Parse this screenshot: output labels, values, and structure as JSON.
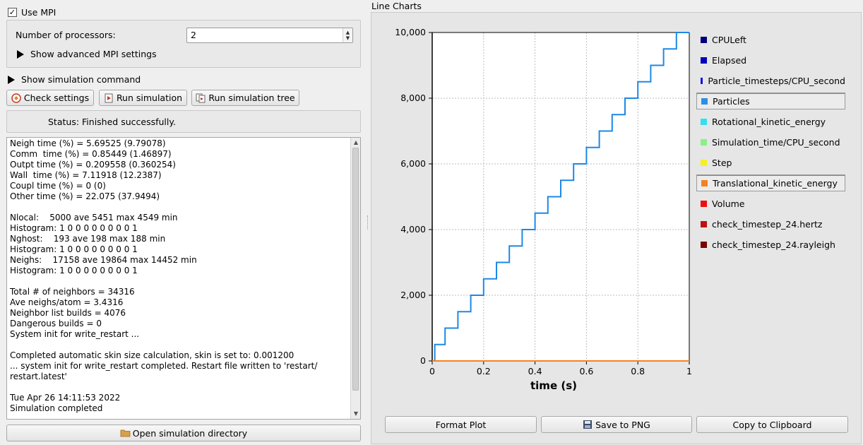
{
  "mpi": {
    "use_mpi_label": "Use MPI",
    "use_mpi_checked": true,
    "processors_label": "Number of processors:",
    "processors_value": "2",
    "advanced_label": "Show advanced MPI settings"
  },
  "simulation_command_label": "Show simulation command",
  "toolbar": {
    "check_settings": "Check settings",
    "run_simulation": "Run simulation",
    "run_simulation_tree": "Run simulation tree"
  },
  "status_text": "Status: Finished successfully.",
  "log_lines": [
    "Neigh time (%) = 5.69525 (9.79078)",
    "Comm  time (%) = 0.85449 (1.46897)",
    "Outpt time (%) = 0.209558 (0.360254)",
    "Wall  time (%) = 7.11918 (12.2387)",
    "Coupl time (%) = 0 (0)",
    "Other time (%) = 22.075 (37.9494)",
    "",
    "Nlocal:    5000 ave 5451 max 4549 min",
    "Histogram: 1 0 0 0 0 0 0 0 0 1",
    "Nghost:    193 ave 198 max 188 min",
    "Histogram: 1 0 0 0 0 0 0 0 0 1",
    "Neighs:    17158 ave 19864 max 14452 min",
    "Histogram: 1 0 0 0 0 0 0 0 0 1",
    "",
    "Total # of neighbors = 34316",
    "Ave neighs/atom = 3.4316",
    "Neighbor list builds = 4076",
    "Dangerous builds = 0",
    "System init for write_restart ...",
    "",
    "Completed automatic skin size calculation, skin is set to: 0.001200",
    "... system init for write_restart completed. Restart file written to 'restart/",
    "restart.latest'",
    "",
    "Tue Apr 26 14:11:53 2022",
    "Simulation completed"
  ],
  "open_dir_label": "Open simulation directory",
  "chart_panel_title": "Line Charts",
  "chart_data": {
    "type": "line",
    "xlabel": "time (s)",
    "ylabel": "",
    "xlim": [
      0,
      1
    ],
    "ylim": [
      0,
      10000
    ],
    "x_ticks": [
      "0",
      "0.2",
      "0.4",
      "0.6",
      "0.8",
      "1"
    ],
    "y_ticks": [
      "0",
      "2,000",
      "4,000",
      "6,000",
      "8,000",
      "10,000"
    ],
    "x_tick_values": [
      0,
      0.2,
      0.4,
      0.6,
      0.8,
      1
    ],
    "y_tick_values": [
      0,
      2000,
      4000,
      6000,
      8000,
      10000
    ],
    "grid": true,
    "series": [
      {
        "name": "Particles",
        "color": "#1e88e5",
        "step": true,
        "x": [
          0,
          0.01,
          0.05,
          0.1,
          0.15,
          0.2,
          0.25,
          0.3,
          0.35,
          0.4,
          0.45,
          0.5,
          0.55,
          0.6,
          0.65,
          0.7,
          0.75,
          0.8,
          0.85,
          0.9,
          0.95,
          1.0
        ],
        "y": [
          0,
          500,
          1000,
          1500,
          2000,
          2500,
          3000,
          3500,
          4000,
          4500,
          5000,
          5500,
          6000,
          6500,
          7000,
          7500,
          8000,
          8500,
          9000,
          9500,
          10000,
          10000
        ]
      },
      {
        "name": "Translational_kinetic_energy",
        "color": "#f5821f",
        "step": false,
        "x": [
          0,
          1
        ],
        "y": [
          0,
          0
        ]
      }
    ]
  },
  "legend": [
    {
      "label": "CPULeft",
      "color": "#00007a",
      "selected": false
    },
    {
      "label": "Elapsed",
      "color": "#0000b8",
      "selected": false
    },
    {
      "label": "Particle_timesteps/CPU_second",
      "color": "#1010e8",
      "selected": false
    },
    {
      "label": "Particles",
      "color": "#2d8fe3",
      "selected": true
    },
    {
      "label": "Rotational_kinetic_energy",
      "color": "#33e0f0",
      "selected": false
    },
    {
      "label": "Simulation_time/CPU_second",
      "color": "#88f288",
      "selected": false
    },
    {
      "label": "Step",
      "color": "#f5f020",
      "selected": false
    },
    {
      "label": "Translational_kinetic_energy",
      "color": "#f5821f",
      "selected": true
    },
    {
      "label": "Volume",
      "color": "#ee1010",
      "selected": false
    },
    {
      "label": "check_timestep_24.hertz",
      "color": "#c01010",
      "selected": false
    },
    {
      "label": "check_timestep_24.rayleigh",
      "color": "#7a0000",
      "selected": false
    }
  ],
  "chart_buttons": {
    "format_plot": "Format Plot",
    "save_png": "Save to PNG",
    "copy_clipboard": "Copy to Clipboard"
  }
}
